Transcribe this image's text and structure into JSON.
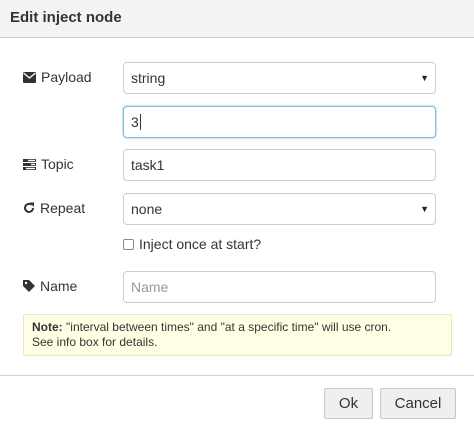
{
  "dialog": {
    "title": "Edit inject node"
  },
  "payload": {
    "label": "Payload",
    "icon": "envelope-icon",
    "type_value": "string",
    "value": "3"
  },
  "topic": {
    "label": "Topic",
    "icon": "tasks-icon",
    "value": "task1"
  },
  "repeat": {
    "label": "Repeat",
    "icon": "repeat-icon",
    "value": "none"
  },
  "inject_once": {
    "label": "Inject once at start?",
    "checked": false
  },
  "name": {
    "label": "Name",
    "icon": "tag-icon",
    "placeholder": "Name",
    "value": ""
  },
  "tip": {
    "note_label": "Note:",
    "line1": "\"interval between times\" and \"at a specific time\" will use cron.",
    "line2": "See info box for details."
  },
  "buttons": {
    "ok": "Ok",
    "cancel": "Cancel"
  },
  "colors": {
    "tip_background": "#ffffe6",
    "focus_border": "#85b7d9",
    "button_background": "#efefef"
  }
}
